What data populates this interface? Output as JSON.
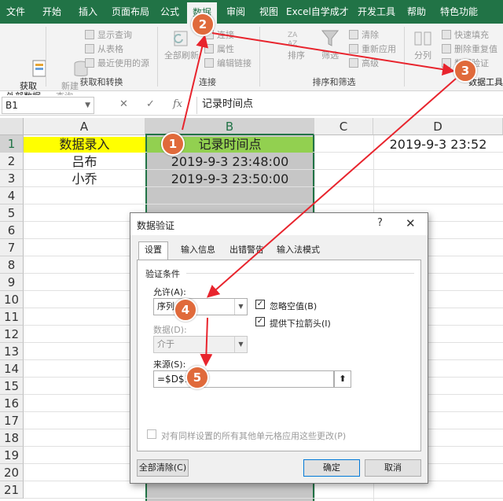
{
  "tabs": [
    "文件",
    "开始",
    "插入",
    "页面布局",
    "公式",
    "数据",
    "审阅",
    "视图",
    "Excel自学成才",
    "开发工具",
    "帮助",
    "特色功能"
  ],
  "ribbon": {
    "get_external": "获取\n外部数据",
    "new_query": "新建\n查询",
    "show_queries": "显示查询",
    "from_table": "从表格",
    "recent_sources": "最近使用的源",
    "group_get": "获取和转换",
    "refresh_all": "全部刷新",
    "connections": "连接",
    "properties": "属性",
    "edit_links": "编辑链接",
    "group_conn": "连接",
    "sort": "排序",
    "filter": "筛选",
    "clear": "清除",
    "reapply": "重新应用",
    "advanced": "高级",
    "group_sort": "排序和筛选",
    "text_to_columns": "分列",
    "flash_fill": "快速填充",
    "remove_dup": "删除重复值",
    "data_validation": "数据验证",
    "group_tools": "数据工具"
  },
  "formula_bar": {
    "name_box": "B1",
    "cancel": "✕",
    "enter": "✓",
    "fx": "fx",
    "formula": "记录时间点"
  },
  "columns": [
    "A",
    "B",
    "C",
    "D"
  ],
  "rows": [
    "1",
    "2",
    "3",
    "4",
    "5",
    "6",
    "7",
    "8",
    "9",
    "10",
    "11",
    "12",
    "13",
    "14",
    "15",
    "16",
    "17",
    "18",
    "19",
    "20",
    "21"
  ],
  "cells": {
    "A1": "数据录入",
    "B1": "记录时间点",
    "D1": "2019-9-3 23:52",
    "A2": "吕布",
    "B2": "2019-9-3 23:48:00",
    "A3": "小乔",
    "B3": "2019-9-3 23:50:00"
  },
  "dialog": {
    "title": "数据验证",
    "help": "?",
    "close": "✕",
    "tabs": [
      "设置",
      "输入信息",
      "出错警告",
      "输入法模式"
    ],
    "criteria_label": "验证条件",
    "allow_label": "允许(A):",
    "allow_value": "序列",
    "ignore_blank": "忽略空值(B)",
    "dropdown": "提供下拉箭头(I)",
    "data_label": "数据(D):",
    "data_value": "介于",
    "source_label": "来源(S):",
    "source_value": "=$D$1",
    "apply_all": "对有同样设置的所有其他单元格应用这些更改(P)",
    "clear_all": "全部清除(C)",
    "ok": "确定",
    "cancel": "取消"
  },
  "annotations": [
    "1",
    "2",
    "3",
    "4",
    "5"
  ],
  "colors": {
    "excel_green": "#217346",
    "header_yellow": "#ffff00",
    "header_green": "#92d050",
    "badge": "#e06a3b",
    "arrow": "#e8242d"
  }
}
